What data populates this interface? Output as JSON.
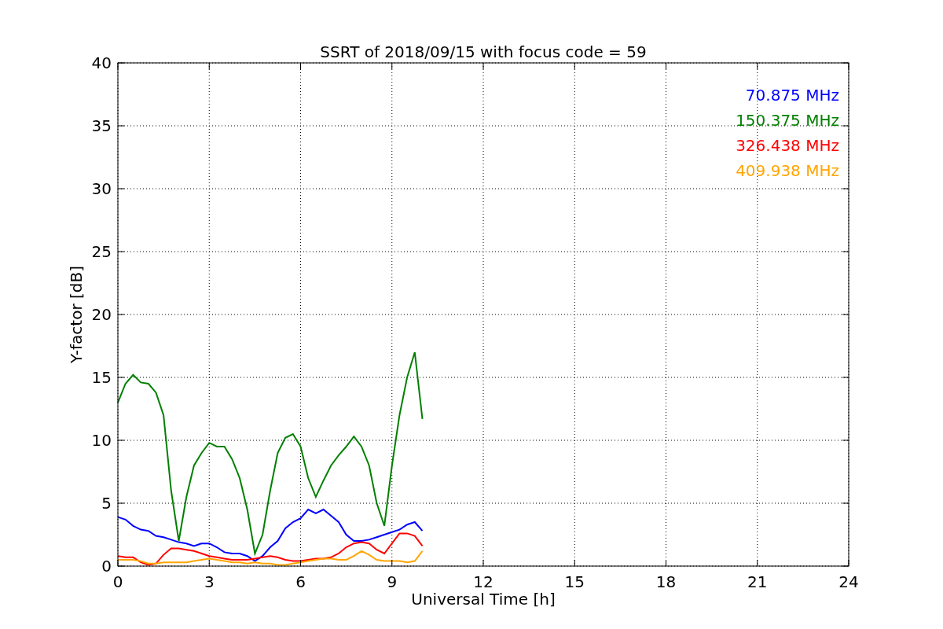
{
  "chart": {
    "chart_data": {
      "type": "line",
      "title": "SSRT of 2018/09/15 with focus code = 59",
      "xlabel": "Universal Time [h]",
      "ylabel": "Y-factor [dB]",
      "x": [
        0,
        0.25,
        0.5,
        0.75,
        1,
        1.25,
        1.5,
        1.75,
        2,
        2.25,
        2.5,
        2.75,
        3,
        3.25,
        3.5,
        3.75,
        4,
        4.25,
        4.5,
        4.75,
        5,
        5.25,
        5.5,
        5.75,
        6,
        6.25,
        6.5,
        6.75,
        7,
        7.25,
        7.5,
        7.75,
        8,
        8.25,
        8.5,
        8.75,
        9,
        9.25,
        9.5,
        9.75,
        10
      ],
      "series": [
        {
          "name": "70.875 MHz",
          "color": "#0000ff",
          "values": [
            3.9,
            3.7,
            3.2,
            2.9,
            2.8,
            2.4,
            2.3,
            2.1,
            1.9,
            1.8,
            1.6,
            1.8,
            1.8,
            1.5,
            1.1,
            1.0,
            1.0,
            0.8,
            0.4,
            0.8,
            1.5,
            2.0,
            3.0,
            3.5,
            3.8,
            4.5,
            4.2,
            4.5,
            4.0,
            3.5,
            2.5,
            2.0,
            2.0,
            2.1,
            2.3,
            2.5,
            2.7,
            2.9,
            3.3,
            3.5,
            2.8
          ]
        },
        {
          "name": "150.375 MHz",
          "color": "#008000",
          "values": [
            13.0,
            14.5,
            15.2,
            14.6,
            14.5,
            13.8,
            12.0,
            6.0,
            2.0,
            5.5,
            8.0,
            9.0,
            9.8,
            9.5,
            9.5,
            8.5,
            7.0,
            4.5,
            1.0,
            2.5,
            6.0,
            9.0,
            10.2,
            10.5,
            9.5,
            7.0,
            5.5,
            6.8,
            8.0,
            8.8,
            9.5,
            10.3,
            9.5,
            8.0,
            5.0,
            3.2,
            8.0,
            12.0,
            15.0,
            17.0,
            11.7
          ]
        },
        {
          "name": "326.438 MHz",
          "color": "#ff0000",
          "values": [
            0.8,
            0.7,
            0.7,
            0.3,
            0.1,
            0.2,
            0.9,
            1.4,
            1.4,
            1.3,
            1.2,
            1.0,
            0.8,
            0.7,
            0.6,
            0.5,
            0.5,
            0.5,
            0.6,
            0.7,
            0.8,
            0.7,
            0.5,
            0.4,
            0.4,
            0.5,
            0.6,
            0.6,
            0.7,
            1.0,
            1.5,
            1.8,
            1.9,
            1.8,
            1.3,
            1.0,
            1.8,
            2.6,
            2.6,
            2.4,
            1.6
          ]
        },
        {
          "name": "409.938 MHz",
          "color": "#ffa500",
          "values": [
            0.5,
            0.5,
            0.5,
            0.4,
            0.2,
            0.2,
            0.3,
            0.3,
            0.3,
            0.3,
            0.4,
            0.5,
            0.6,
            0.5,
            0.4,
            0.3,
            0.3,
            0.2,
            0.3,
            0.2,
            0.2,
            0.1,
            0.1,
            0.2,
            0.3,
            0.4,
            0.5,
            0.6,
            0.6,
            0.5,
            0.5,
            0.8,
            1.2,
            0.9,
            0.5,
            0.4,
            0.4,
            0.4,
            0.3,
            0.4,
            1.2
          ]
        }
      ],
      "grid": true,
      "xlim": [
        0,
        24
      ],
      "ylim": [
        0,
        40
      ],
      "xticks": [
        0,
        3,
        6,
        9,
        12,
        15,
        18,
        21,
        24
      ],
      "yticks": [
        0,
        5,
        10,
        15,
        20,
        25,
        30,
        35,
        40
      ]
    }
  }
}
